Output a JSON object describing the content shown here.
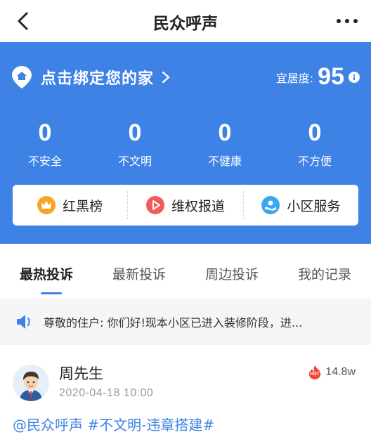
{
  "nav": {
    "title": "民众呼声"
  },
  "hero": {
    "bind_label": "点击绑定您的家",
    "livability_label": "宜居度:",
    "livability_score": "95",
    "stats": [
      {
        "value": "0",
        "label": "不安全"
      },
      {
        "value": "0",
        "label": "不文明"
      },
      {
        "value": "0",
        "label": "不健康"
      },
      {
        "value": "0",
        "label": "不方便"
      }
    ],
    "quick_links": [
      {
        "label": "红黑榜",
        "icon": "crown-icon",
        "color": "#f5a623"
      },
      {
        "label": "维权报道",
        "icon": "play-icon",
        "color": "#f35b5b"
      },
      {
        "label": "小区服务",
        "icon": "hand-service-icon",
        "color": "#3aa8f0"
      }
    ],
    "color": "#3e82e6"
  },
  "tabs": [
    {
      "label": "最热投诉",
      "active": true
    },
    {
      "label": "最新投诉",
      "active": false
    },
    {
      "label": "周边投诉",
      "active": false
    },
    {
      "label": "我的记录",
      "active": false
    }
  ],
  "notice": {
    "text": "尊敬的住户: 你们好!现本小区已进入装修阶段，进..."
  },
  "post": {
    "author": "周先生",
    "time": "2020-04-18  10:00",
    "hot_count": "14.8w",
    "tag_mention": "@民众呼声",
    "tag_topic": "#不文明-违章搭建#"
  }
}
